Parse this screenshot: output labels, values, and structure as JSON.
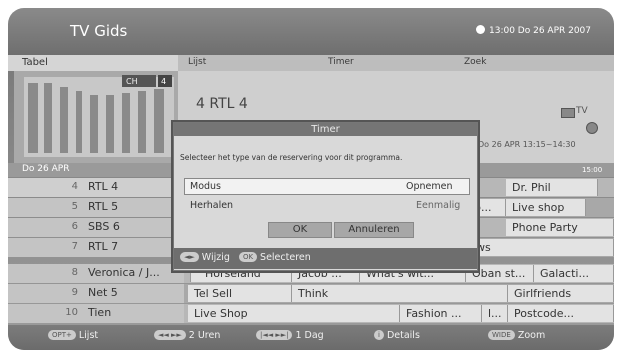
{
  "header": {
    "title": "TV Gids",
    "clock": "13:00 Do 26 APR 2007"
  },
  "tabs": [
    "Tabel",
    "Lijst",
    "Timer",
    "Zoek"
  ],
  "info": {
    "channel": "4 RTL 4",
    "ch_badge": "CH",
    "ch_number": "4",
    "tv_label": "TV",
    "prog_time": "Do 26 APR 13:15~14:30"
  },
  "datebar": {
    "date": "Do 26 APR",
    "time": "15:00"
  },
  "channels": [
    {
      "num": "4",
      "name": "RTL 4",
      "programs": [
        "Dr. Phil"
      ]
    },
    {
      "num": "5",
      "name": "RTL 5",
      "programs": [
        "Live shop"
      ]
    },
    {
      "num": "6",
      "name": "SBS 6",
      "programs": [
        "Phone Party"
      ]
    },
    {
      "num": "7",
      "name": "RTL 7",
      "programs": [
        "ws"
      ]
    },
    {
      "num": "8",
      "name": "Veronica / J...",
      "programs": [
        "Horseland",
        "Jacob ...",
        "What's wit...",
        "Oban st...",
        "Galacti..."
      ]
    },
    {
      "num": "9",
      "name": "Net 5",
      "programs": [
        "Tel Sell",
        "Think",
        "Girlfriends"
      ]
    },
    {
      "num": "10",
      "name": "Tien",
      "programs": [
        "Live Shop",
        "Fashion ...",
        "l...",
        "Postcode..."
      ]
    }
  ],
  "overlap_fragment": "p...",
  "dialog": {
    "title": "Timer",
    "message": "Selecteer het type van de reservering voor dit programma.",
    "options": [
      {
        "label": "Modus",
        "value": "Opnemen"
      },
      {
        "label": "Herhalen",
        "value": "Eenmalig"
      }
    ],
    "ok": "OK",
    "cancel": "Annuleren",
    "hint_nav_key": "◄►",
    "hint_nav": "Wijzig",
    "hint_ok_key": "OK",
    "hint_ok": "Selecteren"
  },
  "footer": [
    {
      "key": "OPT+",
      "label": "Lijst"
    },
    {
      "key": "◄◄ ►►",
      "label": "2 Uren"
    },
    {
      "key": "|◄◄ ►►|",
      "label": "1 Dag"
    },
    {
      "key": "i",
      "label": "Details"
    },
    {
      "key": "WIDE",
      "label": "Zoom"
    }
  ]
}
